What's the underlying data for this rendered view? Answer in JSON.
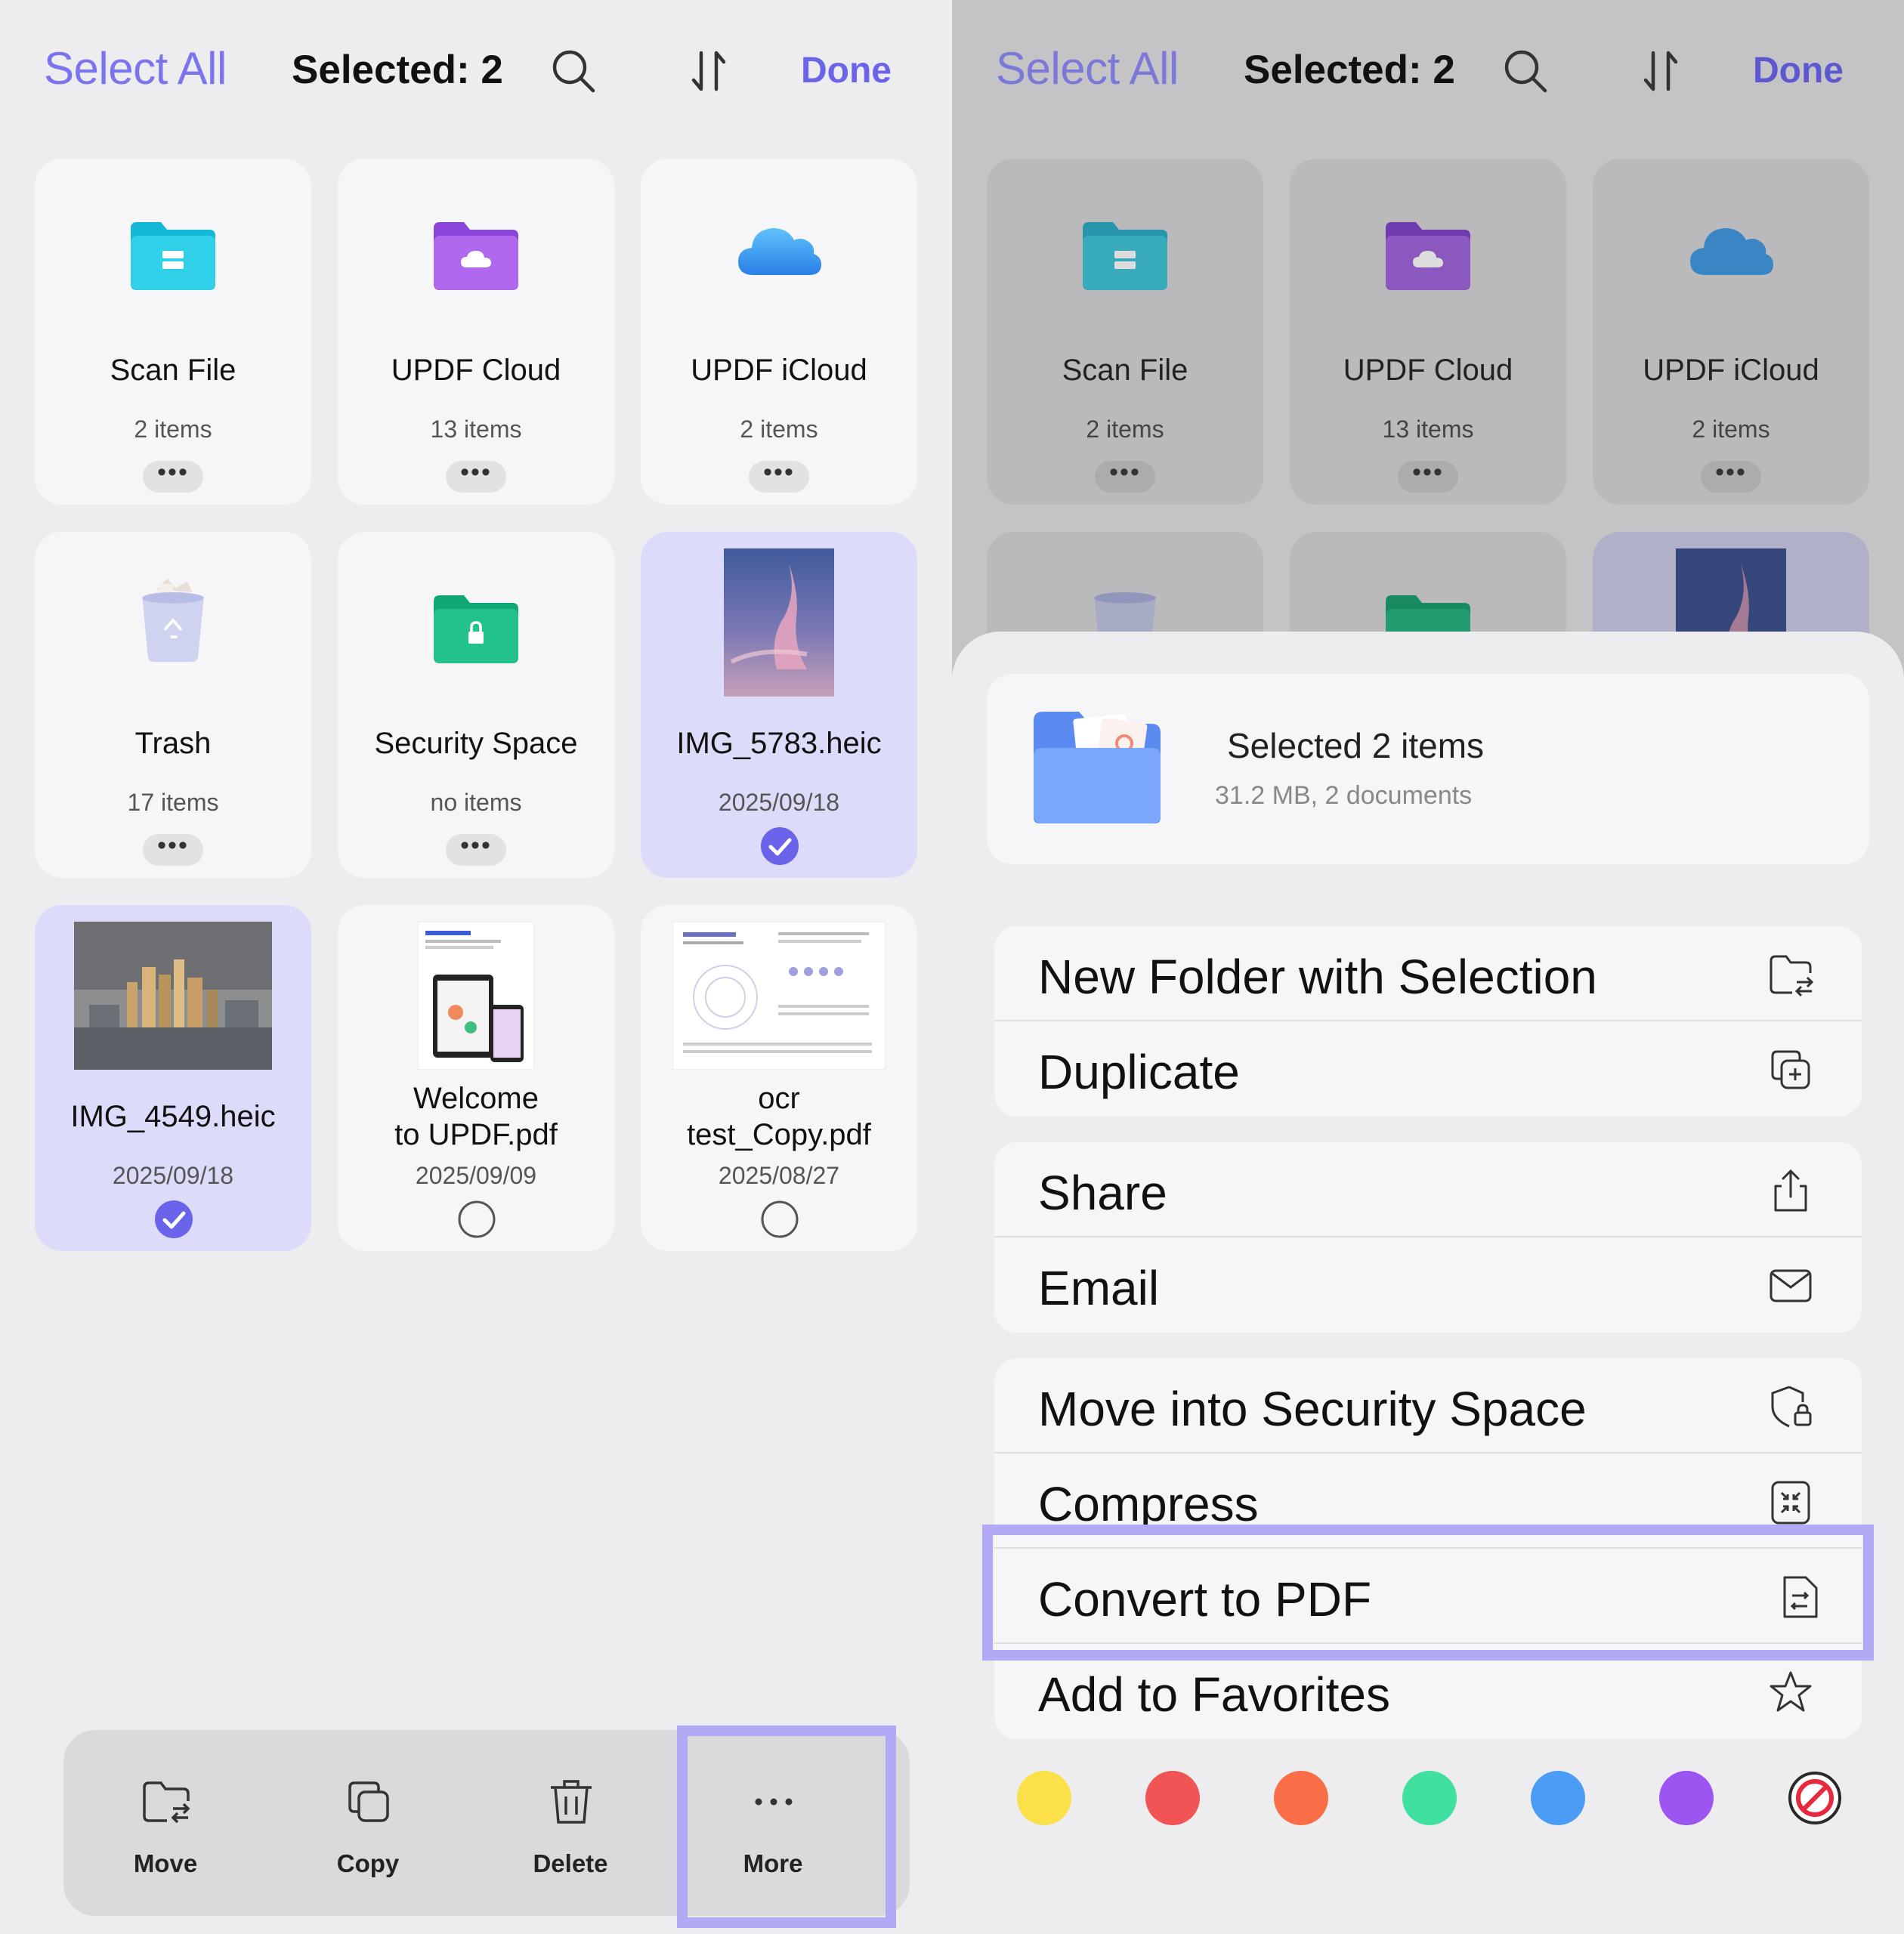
{
  "header": {
    "select_all": "Select All",
    "selected": "Selected: 2",
    "done": "Done"
  },
  "files": [
    {
      "name": "Scan File",
      "meta": "2 items",
      "icon": "scan-folder-icon",
      "color": "#27c3df"
    },
    {
      "name": "UPDF Cloud",
      "meta": "13 items",
      "icon": "cloud-folder-icon",
      "color": "#9f5ce6"
    },
    {
      "name": "UPDF iCloud",
      "meta": "2 items",
      "icon": "icloud-icon",
      "color": "#3b9cf0"
    },
    {
      "name": "Trash",
      "meta": "17 items",
      "icon": "trash-icon"
    },
    {
      "name": "Security Space",
      "meta": "no items",
      "icon": "security-folder-icon",
      "color": "#22c28a"
    },
    {
      "name": "IMG_5783.heic",
      "meta": "2025/09/18",
      "selected": true
    },
    {
      "name": "IMG_4549.heic",
      "meta": "2025/09/18",
      "selected": true
    },
    {
      "name_line1": "Welcome",
      "name_line2": "to UPDF.pdf",
      "meta": "2025/09/09",
      "selected": false
    },
    {
      "name_line1": "ocr",
      "name_line2": "test_Copy.pdf",
      "meta": "2025/08/27",
      "selected": false
    }
  ],
  "more_label": "•••",
  "bottom_bar": [
    {
      "label": "Move",
      "icon": "move-folder-icon"
    },
    {
      "label": "Copy",
      "icon": "copy-icon"
    },
    {
      "label": "Delete",
      "icon": "delete-icon"
    },
    {
      "label": "More",
      "icon": "more-dots-icon"
    }
  ],
  "sheet": {
    "title": "Selected 2 items",
    "subtitle": "31.2 MB, 2 documents",
    "groups": [
      [
        {
          "label": "New Folder with Selection",
          "icon": "new-folder-icon"
        },
        {
          "label": "Duplicate",
          "icon": "duplicate-icon"
        }
      ],
      [
        {
          "label": "Share",
          "icon": "share-icon"
        },
        {
          "label": "Email",
          "icon": "email-icon"
        }
      ],
      [
        {
          "label": "Move into Security Space",
          "icon": "shield-lock-icon"
        },
        {
          "label": "Compress",
          "icon": "compress-icon"
        },
        {
          "label": "Convert to PDF",
          "icon": "convert-pdf-icon"
        },
        {
          "label": "Add to Favorites",
          "icon": "star-icon"
        }
      ]
    ],
    "tag_colors": [
      "#fbe04a",
      "#f05454",
      "#fa6e48",
      "#3fe0a0",
      "#4b9cf5",
      "#9c55f0"
    ],
    "accent": "#7a74ee",
    "highlight": "#b2aaf4"
  }
}
